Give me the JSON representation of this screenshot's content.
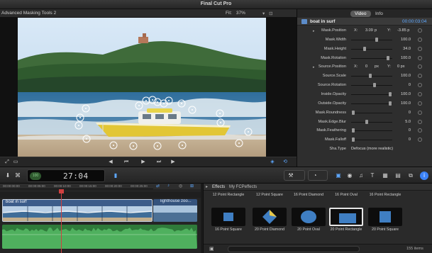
{
  "window": {
    "title": "Final Cut Pro"
  },
  "viewer": {
    "clip_name": "Advanced Masking Tools 2",
    "fit_label": "Fit:",
    "zoom": "37%",
    "controls_icons": [
      "view-options-icon"
    ]
  },
  "transport": {
    "icons": [
      "fullscreen-icon",
      "transform-icon",
      "previous-icon",
      "play-icon",
      "next-icon",
      "loop-icon"
    ]
  },
  "inspector": {
    "tabs": [
      "Video",
      "Info"
    ],
    "clip_name": "boat in surf",
    "clip_timecode": "00:00:03:04",
    "params": [
      {
        "label": "Mask.Position",
        "x_label": "X:",
        "x": "3.09",
        "unit": "p",
        "y_label": "Y:",
        "y": "-3.85 p",
        "type": "xy",
        "expand": true
      },
      {
        "label": "Mask.Width",
        "value": "100.0",
        "knob": 0.6,
        "type": "slider"
      },
      {
        "label": "Mask.Height",
        "value": "34.0",
        "knob": 0.3,
        "type": "slider"
      },
      {
        "label": "Mask.Rotation",
        "value": "100.0",
        "knob": 0.9,
        "type": "slider"
      },
      {
        "label": "Source.Position",
        "x_label": "X:",
        "x": "0",
        "unit": "px",
        "y_label": "Y:",
        "y": "0 px",
        "type": "xy",
        "expand": true
      },
      {
        "label": "Source.Scale",
        "value": "100.0",
        "knob": 0.45,
        "type": "slider"
      },
      {
        "label": "Source.Rotation",
        "value": "0",
        "knob": 0.55,
        "type": "slider"
      },
      {
        "label": "Inside.Opacity",
        "value": "100.0",
        "knob": 0.95,
        "type": "slider"
      },
      {
        "label": "Outside.Opacity",
        "value": "100.0",
        "knob": 0.95,
        "type": "slider"
      },
      {
        "label": "Mask.Roundness",
        "value": "0",
        "knob": 0.02,
        "type": "slider"
      },
      {
        "label": "Mask.Edge.Blur",
        "value": "5.0",
        "knob": 0.35,
        "type": "slider"
      },
      {
        "label": "Mask.Feathering",
        "value": "0",
        "knob": 0.02,
        "type": "slider"
      },
      {
        "label": "Mask.Falloff",
        "value": "0",
        "knob": 0.02,
        "type": "slider"
      },
      {
        "label": "Sha.Type",
        "value": "Defocus (more realistic)",
        "type": "popup"
      }
    ]
  },
  "toolbar": {
    "timecode": "27:04",
    "timecode_badge": "100",
    "right_icons": [
      "tools-icon",
      "speed-icon",
      "clip-appearance-icon",
      "photo-browser-icon",
      "music-browser-icon",
      "title-browser-icon",
      "generators-icon",
      "themes-icon",
      "info-icon"
    ]
  },
  "timeline": {
    "ruler": [
      "00:00:00:00",
      "00:00:05:00",
      "00:00:10:00",
      "00:00:15:00",
      "00:00:20:00",
      "00:00:25:00",
      "00:00:30:00"
    ],
    "clips": [
      {
        "name": "boat in surf"
      },
      {
        "name": "lighthouse zoo..."
      }
    ]
  },
  "effects": {
    "title": "Effects",
    "folder": "My FCPeffects",
    "rows": [
      [
        "12 Point Rectangle",
        "12 Point Square",
        "16 Point Diamond",
        "16 Point Oval",
        "16 Point Rectangle"
      ],
      [
        "16 Point Square",
        "20 Point Diamond",
        "20 Point Oval",
        "20 Point Rectangle",
        "20 Point Square"
      ]
    ],
    "selected": "20 Point Rectangle",
    "count": "155 items"
  },
  "colors": {
    "accent": "#3b82f6",
    "timecode_blue": "#5ea8ff",
    "clip_blue": "#3c5c8a",
    "audio_green": "#2f7a3a"
  }
}
